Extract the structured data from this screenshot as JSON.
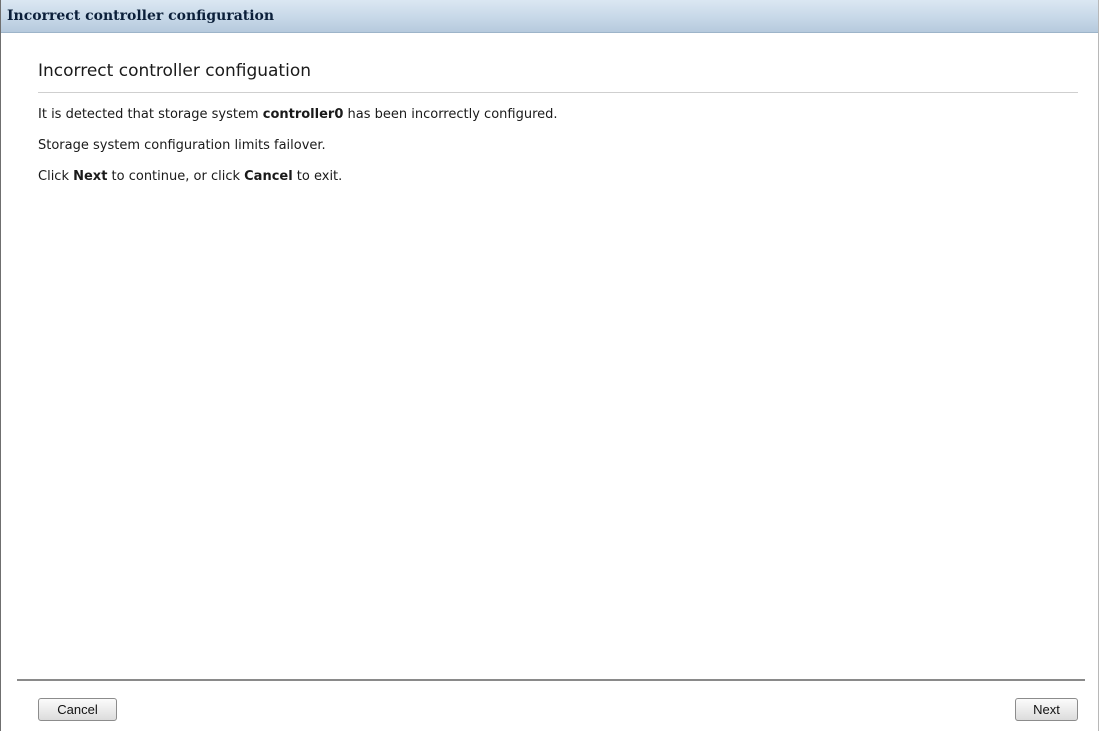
{
  "window": {
    "title": "Incorrect controller configuration"
  },
  "main": {
    "heading": "Incorrect controller configuation",
    "line1": {
      "before": "It is detected that storage system ",
      "bold": "controller0",
      "after": " has been incorrectly configured."
    },
    "line2": "Storage system configuration limits failover.",
    "line3": {
      "prefix": "Click ",
      "next_word": "Next",
      "middle": " to continue, or click ",
      "cancel_word": "Cancel",
      "suffix": " to exit."
    }
  },
  "footer": {
    "cancel_label": "Cancel",
    "next_label": "Next"
  },
  "colors": {
    "titlebar_top": "#dbe7f2",
    "titlebar_bottom": "#b6cadd",
    "title_text": "#0b1f3a",
    "footer_rule": "#8a8a8a"
  }
}
